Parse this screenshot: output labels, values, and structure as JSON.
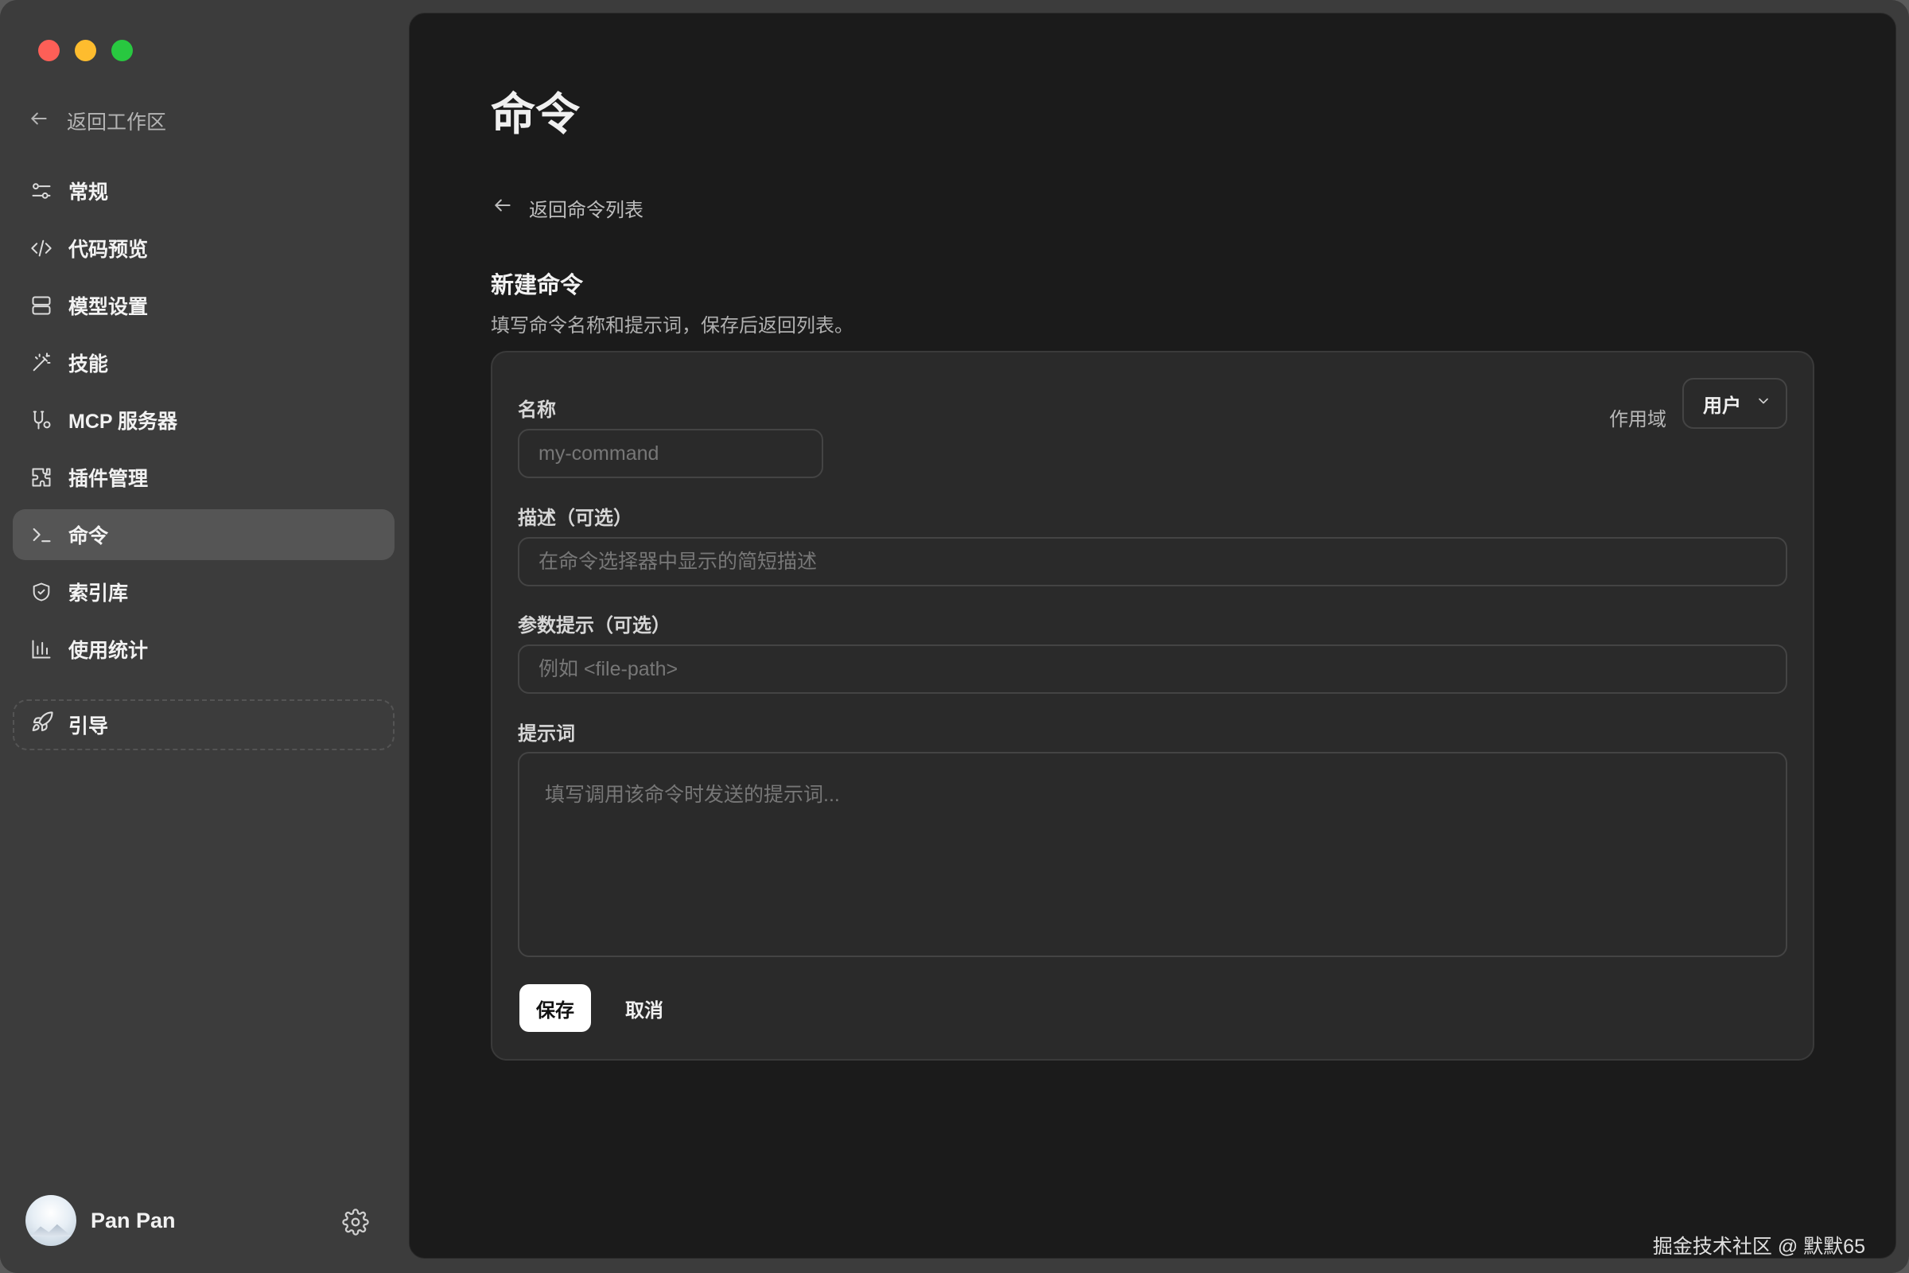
{
  "sidebar": {
    "back_label": "返回工作区",
    "items": [
      {
        "label": "常规",
        "icon": "sliders-icon"
      },
      {
        "label": "代码预览",
        "icon": "code-icon"
      },
      {
        "label": "模型设置",
        "icon": "server-icon"
      },
      {
        "label": "技能",
        "icon": "magic-wand-icon"
      },
      {
        "label": "MCP 服务器",
        "icon": "mcp-icon"
      },
      {
        "label": "插件管理",
        "icon": "puzzle-icon"
      },
      {
        "label": "命令",
        "icon": "terminal-icon",
        "active": true
      },
      {
        "label": "索引库",
        "icon": "shield-icon"
      },
      {
        "label": "使用统计",
        "icon": "bar-chart-icon"
      }
    ],
    "guide_label": "引导",
    "user_name": "Pan Pan"
  },
  "main": {
    "title": "命令",
    "back_label": "返回命令列表",
    "section_title": "新建命令",
    "section_desc": "填写命令名称和提示词，保存后返回列表。",
    "form": {
      "name_label": "名称",
      "name_placeholder": "my-command",
      "scope_label": "作用域",
      "scope_value": "用户",
      "desc_label": "描述（可选）",
      "desc_placeholder": "在命令选择器中显示的简短描述",
      "args_label": "参数提示（可选）",
      "args_placeholder": "例如 <file-path>",
      "prompt_label": "提示词",
      "prompt_placeholder": "填写调用该命令时发送的提示词...",
      "save_label": "保存",
      "cancel_label": "取消"
    }
  },
  "watermark": "掘金技术社区 @ 默默65"
}
